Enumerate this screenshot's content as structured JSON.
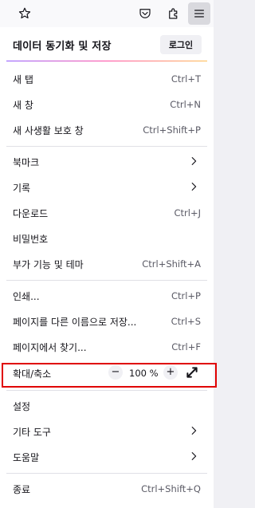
{
  "toolbar": {
    "bookmark_icon": "star-icon",
    "pocket_icon": "pocket-icon",
    "extensions_icon": "puzzle-icon",
    "menu_icon": "hamburger-menu-icon"
  },
  "sync": {
    "title": "데이터 동기화 및 저장",
    "login_label": "로그인"
  },
  "menu": {
    "new_tab": {
      "label": "새 탭",
      "shortcut": "Ctrl+T"
    },
    "new_window": {
      "label": "새 창",
      "shortcut": "Ctrl+N"
    },
    "private_window": {
      "label": "새 사생활 보호 창",
      "shortcut": "Ctrl+Shift+P"
    },
    "bookmarks": {
      "label": "북마크"
    },
    "history": {
      "label": "기록"
    },
    "downloads": {
      "label": "다운로드",
      "shortcut": "Ctrl+J"
    },
    "passwords": {
      "label": "비밀번호"
    },
    "addons": {
      "label": "부가 기능 및 테마",
      "shortcut": "Ctrl+Shift+A"
    },
    "print": {
      "label": "인쇄...",
      "shortcut": "Ctrl+P"
    },
    "save_as": {
      "label": "페이지를 다른 이름으로 저장...",
      "shortcut": "Ctrl+S"
    },
    "find": {
      "label": "페이지에서 찾기...",
      "shortcut": "Ctrl+F"
    },
    "zoom": {
      "label": "확대/축소",
      "minus": "−",
      "value": "100 %",
      "plus": "+"
    },
    "settings": {
      "label": "설정"
    },
    "more_tools": {
      "label": "기타 도구"
    },
    "help": {
      "label": "도움말"
    },
    "quit": {
      "label": "종료",
      "shortcut": "Ctrl+Shift+Q"
    }
  },
  "colors": {
    "highlight": "#e00000",
    "gradient": [
      "#9059ff",
      "#ff4aa2",
      "#ffbd4f"
    ]
  }
}
